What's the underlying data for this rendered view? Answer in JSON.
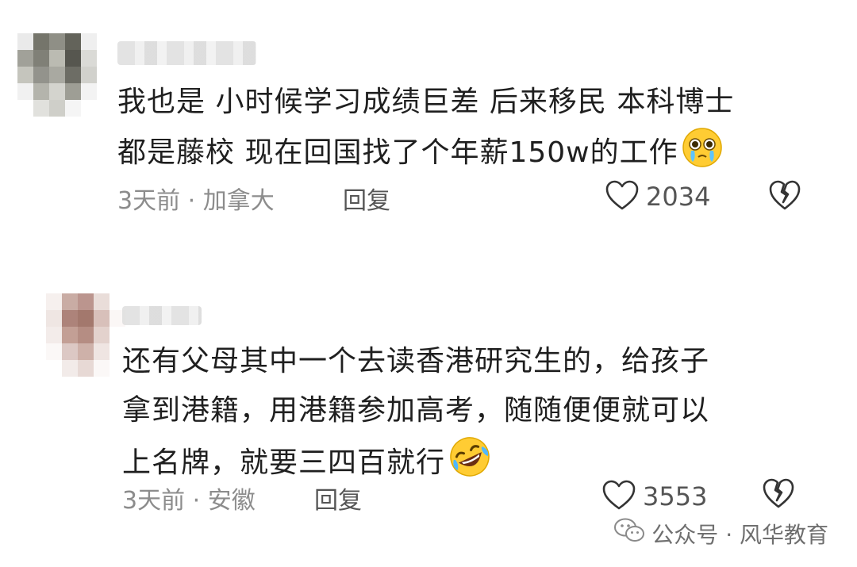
{
  "comments": [
    {
      "lines": [
        "我也是 小时候学习成绩巨差 后来移民 本科博士",
        "都是藤校 现在回国找了个年薪150w的工作"
      ],
      "emoji": "pleading-crying-face",
      "time": "3天前",
      "separator": "·",
      "location": "加拿大",
      "reply_label": "回复",
      "likes": "2034"
    },
    {
      "lines": [
        "还有父母其中一个去读香港研究生的，给孩子",
        "拿到港籍，用港籍参加高考，随随便便就可以",
        "上名牌，就要三四百就行"
      ],
      "emoji": "rolling-laughing-face",
      "time": "3天前",
      "separator": "·",
      "location": "安徽",
      "reply_label": "回复",
      "likes": "3553"
    }
  ],
  "watermark": {
    "icon": "wechat-icon",
    "text": "公众号 · 风华教育"
  }
}
